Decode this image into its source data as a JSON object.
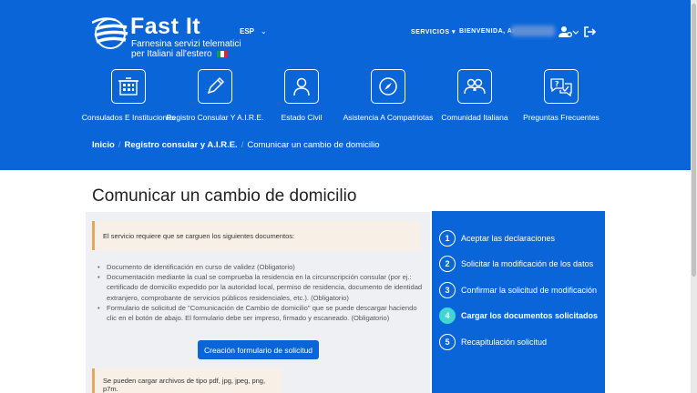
{
  "brand": {
    "title": "Fast It",
    "subtitle_line1": "Farnesina servizi telematici",
    "subtitle_line2": "per Italiani all'estero"
  },
  "header": {
    "language": "ESP",
    "services": "SERVICIOS ▾",
    "welcome": "BIENVENIDA, An"
  },
  "nav": [
    {
      "label": "Consulados E Instituciones",
      "icon": "building-icon"
    },
    {
      "label": "Registro Consular Y A.I.R.E.",
      "icon": "pencil-icon"
    },
    {
      "label": "Estado Civil",
      "icon": "person-icon"
    },
    {
      "label": "Asistencia A Compatriotas",
      "icon": "compass-icon"
    },
    {
      "label": "Comunidad Italiana",
      "icon": "group-icon"
    },
    {
      "label": "Preguntas Frecuentes",
      "icon": "chat-question-icon"
    }
  ],
  "breadcrumb": {
    "home": "Inicio",
    "section": "Registro consular y A.I.R.E.",
    "current": "Comunicar un cambio de domicilio"
  },
  "page": {
    "title": "Comunicar un cambio de domicilio"
  },
  "main": {
    "notice_docs": "El servicio requiere que se carguen los siguientes documentos:",
    "documents": [
      "Documento de identificación en curso de validez (Obligatorio)",
      "Documentación mediante la cual se comprueba la residencia en la circunscripción consular (por ej.: certificado de domicilio expedido por la autoridad local, permiso de residencia, documento de identidad extranjero, comprobante de servicios públicos residenciales, etc.). (Obligatorio)",
      "Formulario de solicitud de \"Comunicación de Cambio de domicilio\" que se puede descargar haciendo clic en el botón de abajo. El formulario debe ser impreso, firmado y escaneado. (Obligatorio)"
    ],
    "create_button": "Creación formulario de solicitud",
    "notice_files": "Se pueden cargar archivos de tipo pdf, jpg, jpeg, png, p7m."
  },
  "steps": [
    {
      "num": "1",
      "label": "Aceptar las declaraciones"
    },
    {
      "num": "2",
      "label": "Solicitar la modificación de los datos"
    },
    {
      "num": "3",
      "label": "Confirmar la solicitud de modificación"
    },
    {
      "num": "4",
      "label": "Cargar los documentos solicitados"
    },
    {
      "num": "5",
      "label": "Recapitulación solicitud"
    }
  ],
  "colors": {
    "header_blue": "#0a66d8",
    "active_step": "#3fd6d4",
    "notice_border": "#e8a55c"
  }
}
